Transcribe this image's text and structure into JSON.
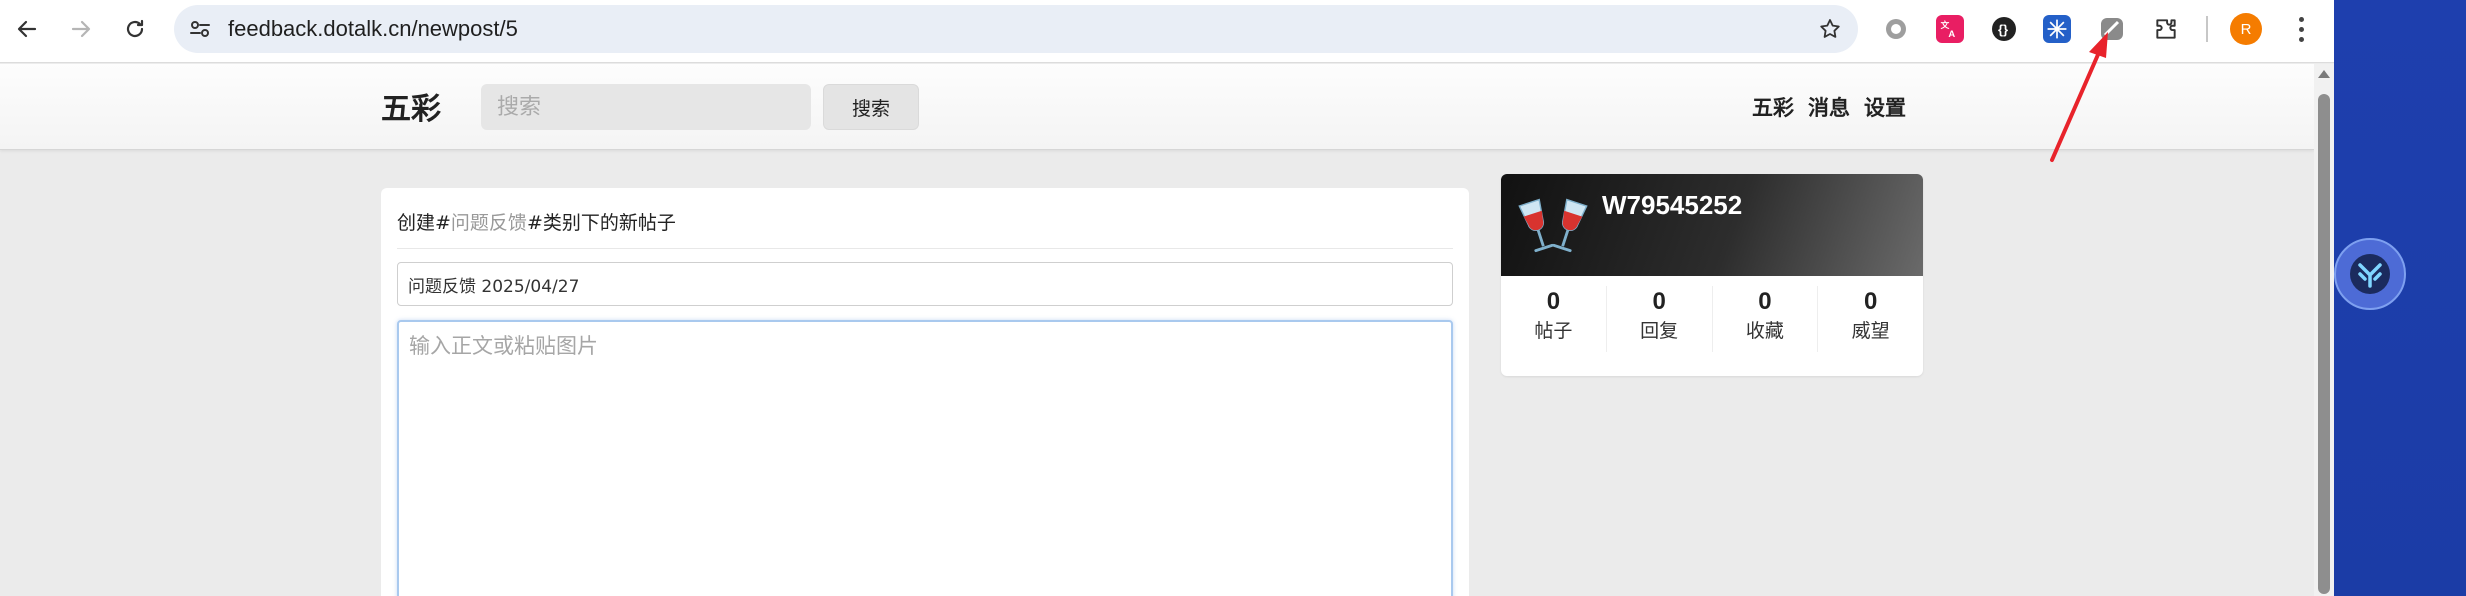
{
  "browser": {
    "url": "feedback.dotalk.cn/newpost/5",
    "profile_initial": "R",
    "extensions": [
      "circle-extension-icon",
      "translate-extension-icon",
      "black-circle-extension-icon",
      "blue-grid-extension-icon",
      "gray-extension-icon",
      "puzzle-extensions-icon"
    ]
  },
  "header": {
    "logo": "五彩",
    "search_placeholder": "搜索",
    "search_button": "搜索",
    "links": [
      "五彩",
      "消息",
      "设置"
    ]
  },
  "post": {
    "title_prefix": "创建#",
    "category": "问题反馈",
    "title_suffix": "#类别下的新帖子",
    "title_value": "问题反馈 2025/04/27",
    "body_placeholder": "输入正文或粘贴图片"
  },
  "user": {
    "name": "W79545252",
    "stats": [
      {
        "value": "0",
        "label": "帖子"
      },
      {
        "value": "0",
        "label": "回复"
      },
      {
        "value": "0",
        "label": "收藏"
      },
      {
        "value": "0",
        "label": "威望"
      }
    ]
  },
  "colors": {
    "accent_arrow": "#e8232b",
    "desktop_blue": "#1e3fae",
    "profile_orange": "#f57c00"
  }
}
